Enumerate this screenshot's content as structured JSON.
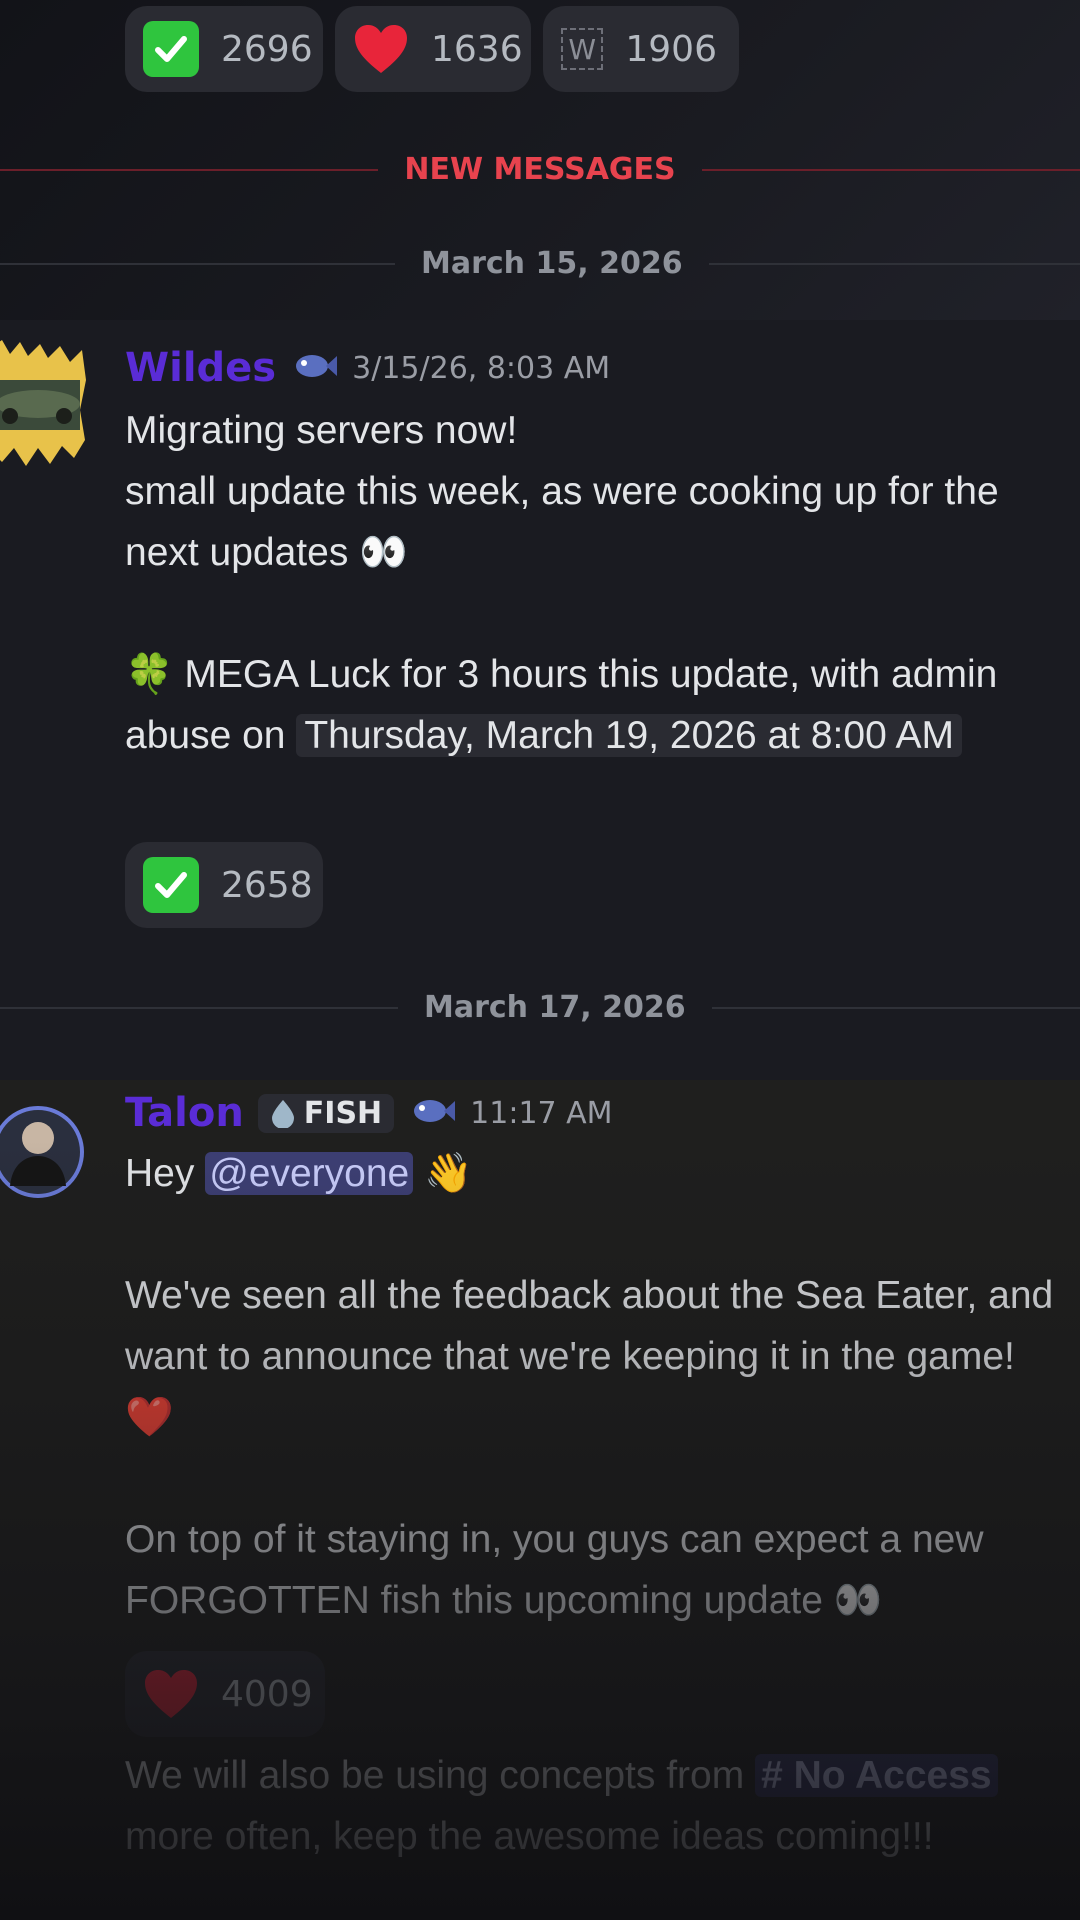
{
  "top_reactions": [
    {
      "icon": "check-mark-icon",
      "count": "2696"
    },
    {
      "icon": "heart-icon",
      "count": "1636"
    },
    {
      "icon": "w-emoji-icon",
      "glyph": "W",
      "count": "1906"
    }
  ],
  "new_messages_label": "NEW MESSAGES",
  "date1": "March 15, 2026",
  "date2": "March 17, 2026",
  "msg1": {
    "username": "Wildes",
    "timestamp": "3/15/26, 8:03 AM",
    "line1": "Migrating servers now!",
    "line2": "small update this week, as were cooking up for the next updates 👀",
    "line3_pre": "🍀 MEGA Luck for 3 hours this update, with admin abuse on ",
    "line3_ts": "Thursday, March 19, 2026 at 8:00 AM",
    "reaction_count": "2658"
  },
  "msg2": {
    "username": "Talon",
    "role_tag": "FISH",
    "timestamp": "11:17 AM",
    "hey": "Hey ",
    "mention": "@everyone",
    "wave": " 👋",
    "para1": "We've seen all the feedback about the Sea Eater, and want to announce that we're keeping it in the game! ❤️",
    "para2": "On top of it staying in, you guys can expect a new FORGOTTEN fish this upcoming update  👀",
    "reaction_count": "4009",
    "para3_pre": "We will also be using concepts from ",
    "channel": "No Access",
    "para3_post": " more often, keep the awesome ideas coming!!!"
  },
  "colors": {
    "accent_red": "#e8434e",
    "username": "#5a2cd6",
    "reaction_bg": "#2a2b32"
  }
}
